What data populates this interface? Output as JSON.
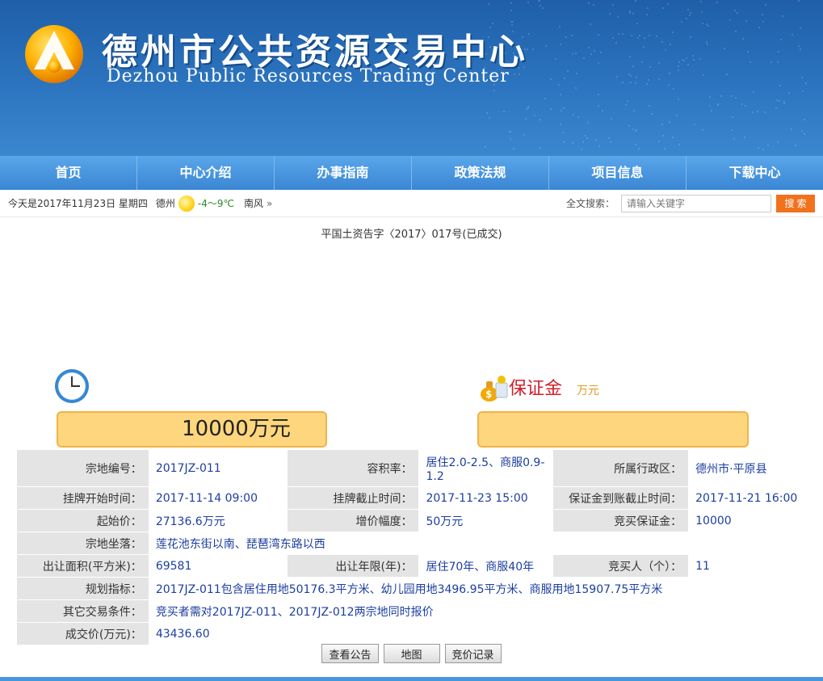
{
  "header": {
    "title": "德州市公共资源交易中心",
    "subtitle": "Dezhou Public Resources Trading Center"
  },
  "nav": [
    {
      "label": "首页"
    },
    {
      "label": "中心介绍"
    },
    {
      "label": "办事指南"
    },
    {
      "label": "政策法规"
    },
    {
      "label": "项目信息"
    },
    {
      "label": "下载中心"
    }
  ],
  "infobar": {
    "date": "今天是2017年11月23日 星期四",
    "city": "德州",
    "temp": "-4～9℃",
    "wind": "南风",
    "more": "»",
    "search_label": "全文搜索：",
    "search_placeholder": "请输入关键字",
    "search_button": "搜 索"
  },
  "doc_title": "平国土资告字〈2017〉017号(已成交)",
  "price": {
    "current": "10000万元",
    "deposit_label": "保证金",
    "deposit_unit": "万元"
  },
  "table": {
    "r1": {
      "k1": "宗地编号：",
      "v1": "2017JZ-011",
      "k2": "容积率：",
      "v2": "居住2.0-2.5、商服0.9-1.2",
      "k3": "所属行政区：",
      "v3": "德州市·平原县"
    },
    "r2": {
      "k1": "挂牌开始时间：",
      "v1": "2017-11-14 09:00",
      "k2": "挂牌截止时间：",
      "v2": "2017-11-23 15:00",
      "k3": "保证金到账截止时间：",
      "v3": "2017-11-21 16:00"
    },
    "r3": {
      "k1": "起始价：",
      "v1": "27136.6万元",
      "k2": "增价幅度：",
      "v2": "50万元",
      "k3": "竞买保证金：",
      "v3": "10000"
    },
    "r4": {
      "k1": "宗地坐落：",
      "v1": "莲花池东街以南、琵琶湾东路以西"
    },
    "r5": {
      "k1": "出让面积(平方米)：",
      "v1": "69581",
      "k2": "出让年限(年)：",
      "v2": "居住70年、商服40年",
      "k3": "竞买人（个）：",
      "v3": "11"
    },
    "r6": {
      "k1": "规划指标：",
      "v1": "2017JZ-011包含居住用地50176.3平方米、幼儿园用地3496.95平方米、商服用地15907.75平方米"
    },
    "r7": {
      "k1": "其它交易条件：",
      "v1": "竞买者需对2017JZ-011、2017JZ-012两宗地同时报价"
    },
    "r8": {
      "k1": "成交价(万元)：",
      "v1": "43436.60"
    }
  },
  "buttons": {
    "notice": "查看公告",
    "map": "地图",
    "bids": "竞价记录"
  }
}
